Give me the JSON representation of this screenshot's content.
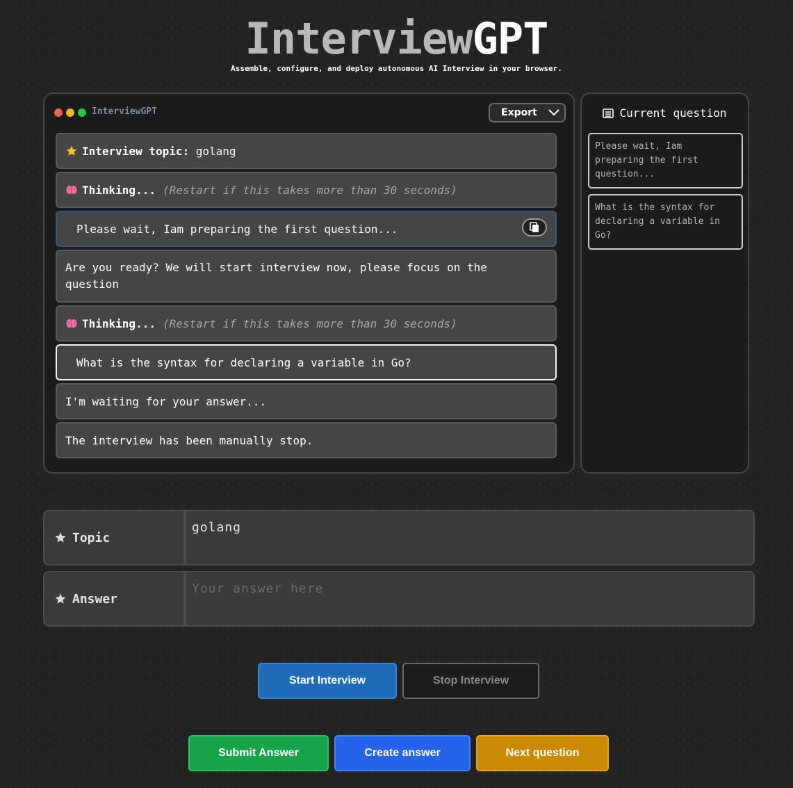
{
  "header": {
    "title_part1": "Interview",
    "title_part2": "GPT",
    "subtitle": "Assemble, configure, and deploy autonomous AI Interview in your browser."
  },
  "chat_window": {
    "title": "InterviewGPT",
    "export_label": "Export",
    "traffic_lights": [
      "#ec5f57",
      "#f2b12d",
      "#2bc540"
    ],
    "messages": [
      {
        "icon": "star-icon",
        "label": "Interview topic:",
        "text": "golang"
      },
      {
        "icon": "brain-icon",
        "label": "Thinking...",
        "note": "(Restart if this takes more than 30 seconds)"
      },
      {
        "text": "Please wait, Iam preparing the first question..."
      },
      {
        "text": "Are you ready? We will start interview now, please focus on the question"
      },
      {
        "icon": "brain-icon",
        "label": "Thinking...",
        "note": "(Restart if this takes more than 30 seconds)"
      },
      {
        "text": "What is the syntax for declaring a variable in Go?"
      },
      {
        "text": "I'm waiting for your answer..."
      },
      {
        "text": "The interview has been manually stop."
      }
    ]
  },
  "question_panel": {
    "title": "Current question",
    "questions": [
      "Please wait, Iam preparing the first question...",
      "What is the syntax for declaring a variable in Go?"
    ]
  },
  "form": {
    "topic_label": "Topic",
    "topic_value": "golang",
    "answer_label": "Answer",
    "answer_placeholder": "Your answer here"
  },
  "buttons": {
    "start": "Start Interview",
    "stop": "Stop Interview",
    "submit": "Submit Answer",
    "create": "Create answer",
    "next": "Next question"
  },
  "colors": {
    "start": "#1f6bb8",
    "submit": "#16a34a",
    "create": "#2563eb",
    "next": "#ca8a04"
  }
}
